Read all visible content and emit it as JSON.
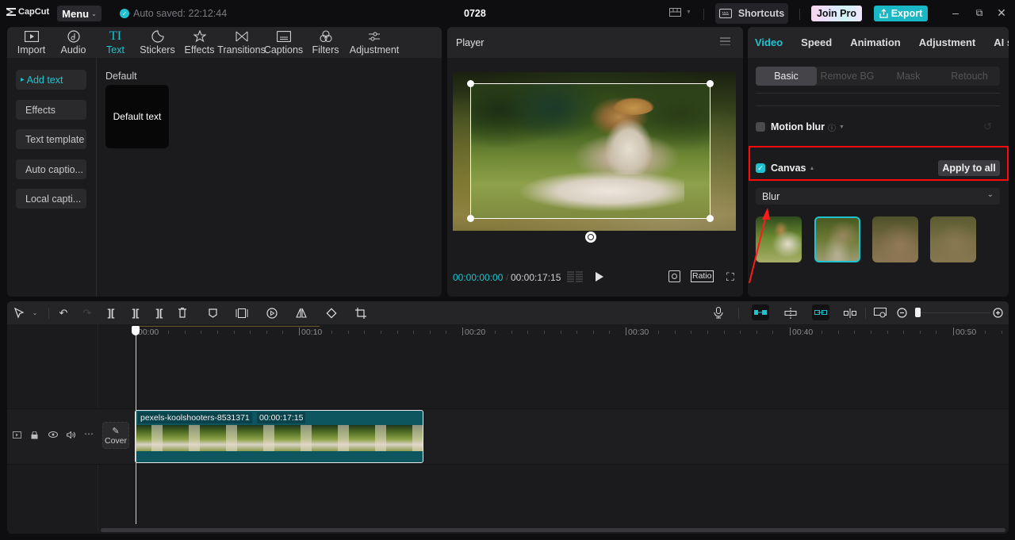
{
  "app": {
    "logo": "CapCut",
    "menu_label": "Menu",
    "autosave": "Auto saved: 22:12:44",
    "project_title": "0728",
    "shortcuts_label": "Shortcuts",
    "join_pro_label": "Join Pro",
    "export_label": "Export"
  },
  "media_tabs": [
    {
      "label": "Import",
      "icon": "import-icon"
    },
    {
      "label": "Audio",
      "icon": "audio-icon"
    },
    {
      "label": "Text",
      "icon": "text-icon",
      "active": true
    },
    {
      "label": "Stickers",
      "icon": "sticker-icon"
    },
    {
      "label": "Effects",
      "icon": "effects-icon"
    },
    {
      "label": "Transitions",
      "icon": "transitions-icon"
    },
    {
      "label": "Captions",
      "icon": "captions-icon"
    },
    {
      "label": "Filters",
      "icon": "filters-icon"
    },
    {
      "label": "Adjustment",
      "icon": "adjustment-icon"
    }
  ],
  "text_sidebar": [
    {
      "label": "Add text",
      "active": true
    },
    {
      "label": "Effects"
    },
    {
      "label": "Text template"
    },
    {
      "label": "Auto captio..."
    },
    {
      "label": "Local capti..."
    }
  ],
  "text_content": {
    "section": "Default",
    "card_label": "Default text"
  },
  "player": {
    "title": "Player",
    "current_time": "00:00:00:00",
    "separator": "/",
    "total_time": "00:00:17:15",
    "ratio_label": "Ratio"
  },
  "inspector": {
    "tabs": [
      {
        "label": "Video",
        "active": true
      },
      {
        "label": "Speed"
      },
      {
        "label": "Animation"
      },
      {
        "label": "Adjustment"
      },
      {
        "label": "AI st"
      }
    ],
    "subtabs": [
      {
        "label": "Basic",
        "active": true
      },
      {
        "label": "Remove BG"
      },
      {
        "label": "Mask"
      },
      {
        "label": "Retouch"
      }
    ],
    "motion_blur": {
      "label": "Motion blur",
      "checked": false
    },
    "canvas": {
      "label": "Canvas",
      "checked": true,
      "apply_all_label": "Apply to all"
    },
    "canvas_type": {
      "selected": "Blur"
    },
    "blur_options": [
      {
        "name": "blur-level-none",
        "selected": false
      },
      {
        "name": "blur-level-1",
        "selected": true
      },
      {
        "name": "blur-level-2",
        "selected": false
      },
      {
        "name": "blur-level-3",
        "selected": false
      }
    ],
    "highlight_color": "#ff0a0a"
  },
  "timeline": {
    "ruler_labels": [
      "00:00",
      "00:10",
      "00:20",
      "00:30",
      "00:40",
      "00:50"
    ],
    "clip": {
      "name": "pexels-koolshooters-8531371",
      "duration": "00:00:17:15"
    },
    "cover_label": "Cover"
  },
  "colors": {
    "accent": "#1fc3cf",
    "clip": "#0d5660",
    "background": "#1b1b1d"
  }
}
